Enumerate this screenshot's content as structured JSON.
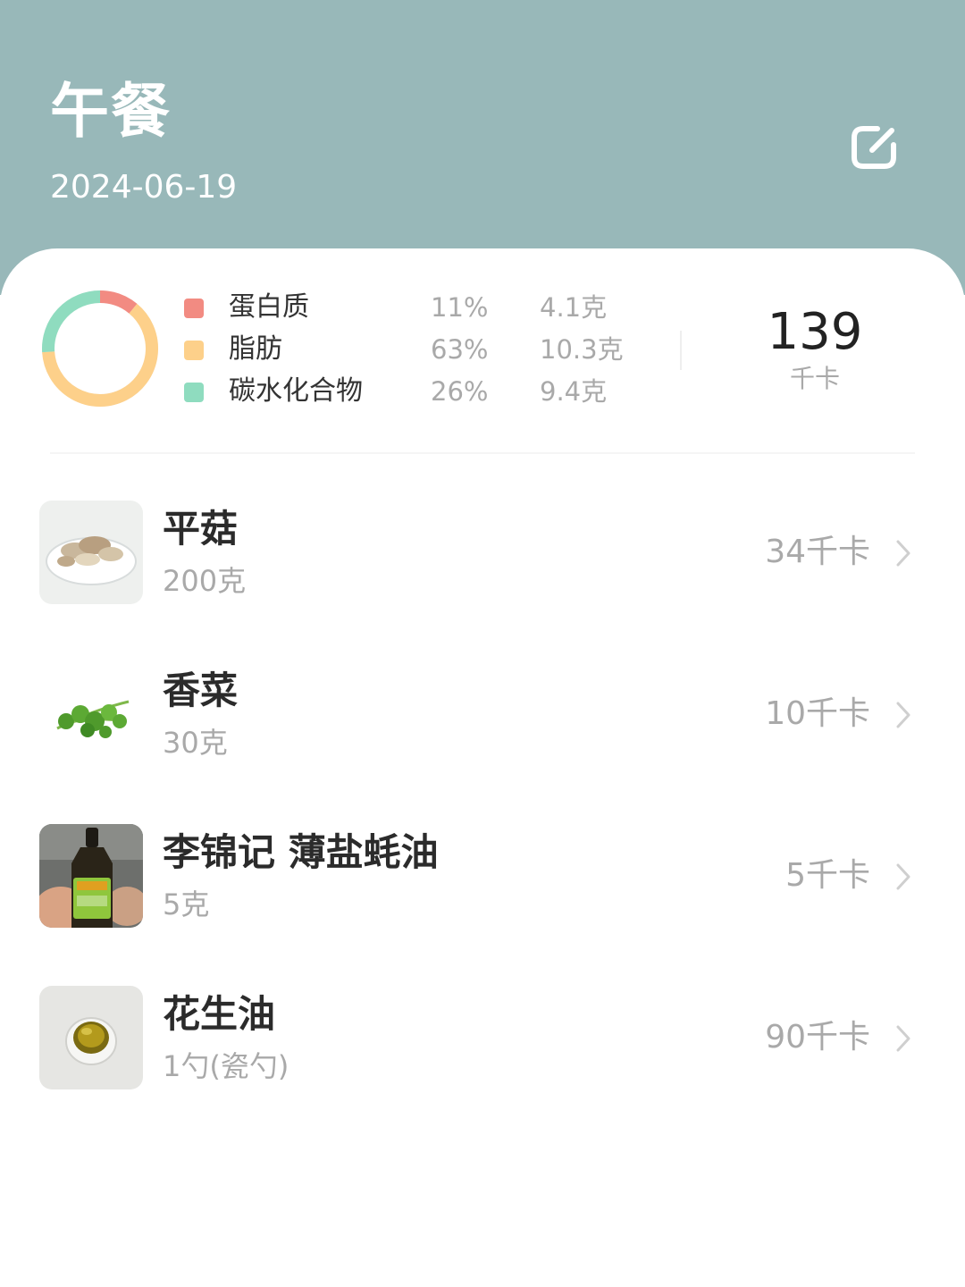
{
  "header": {
    "title": "午餐",
    "date": "2024-06-19",
    "edit_icon": "edit-icon"
  },
  "summary": {
    "macros": [
      {
        "name": "蛋白质",
        "percent": "11%",
        "amount": "4.1克",
        "color": "#f28b82",
        "fraction": 0.11
      },
      {
        "name": "脂肪",
        "percent": "63%",
        "amount": "10.3克",
        "color": "#fdd08a",
        "fraction": 0.63
      },
      {
        "name": "碳水化合物",
        "percent": "26%",
        "amount": "9.4克",
        "color": "#8fdcbf",
        "fraction": 0.26
      }
    ],
    "total_kcal": "139",
    "kcal_unit": "千卡"
  },
  "foods": [
    {
      "name": "平菇",
      "amount": "200克",
      "kcal": "34千卡",
      "thumb": "oyster-mushroom-photo"
    },
    {
      "name": "香菜",
      "amount": "30克",
      "kcal": "10千卡",
      "thumb": "cilantro-photo"
    },
    {
      "name": "李锦记 薄盐蚝油",
      "amount": "5克",
      "kcal": "5千卡",
      "thumb": "oyster-sauce-bottle-photo"
    },
    {
      "name": "花生油",
      "amount": "1勺(瓷勺)",
      "kcal": "90千卡",
      "thumb": "peanut-oil-dish-photo"
    }
  ]
}
